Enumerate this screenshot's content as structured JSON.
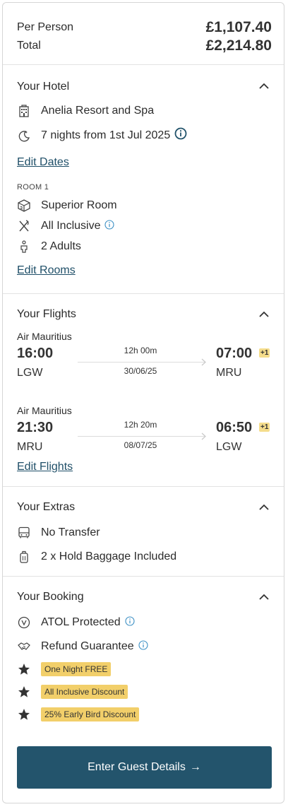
{
  "price": {
    "per_person_label": "Per Person",
    "per_person_value": "£1,107.40",
    "total_label": "Total",
    "total_value": "£2,214.80"
  },
  "hotel": {
    "title": "Your Hotel",
    "name": "Anelia Resort and Spa",
    "nights": "7 nights from 1st Jul 2025",
    "edit_dates": "Edit Dates",
    "room_label": "ROOM 1",
    "room_type": "Superior Room",
    "board": "All Inclusive",
    "guests": "2 Adults",
    "edit_rooms": "Edit Rooms"
  },
  "flights": {
    "title": "Your Flights",
    "legs": [
      {
        "airline": "Air Mauritius",
        "depart_time": "16:00",
        "depart_code": "LGW",
        "duration": "12h 00m",
        "date": "30/06/25",
        "arrive_time": "07:00",
        "arrive_code": "MRU",
        "day_offset": "+1"
      },
      {
        "airline": "Air Mauritius",
        "depart_time": "21:30",
        "depart_code": "MRU",
        "duration": "12h 20m",
        "date": "08/07/25",
        "arrive_time": "06:50",
        "arrive_code": "LGW",
        "day_offset": "+1"
      }
    ],
    "edit_flights": "Edit Flights"
  },
  "extras": {
    "title": "Your Extras",
    "transfer": "No Transfer",
    "baggage": "2 x Hold Baggage Included"
  },
  "booking": {
    "title": "Your Booking",
    "atol": "ATOL Protected",
    "refund": "Refund Guarantee",
    "offers": [
      "One Night FREE",
      "All Inclusive Discount",
      "25% Early Bird Discount"
    ]
  },
  "cta": {
    "label": "Enter Guest Details",
    "arrow": "→"
  },
  "colors": {
    "link": "#1f4f68",
    "cta_bg": "#23546c",
    "badge": "#f2cf6a",
    "info": "#3b8fc4"
  }
}
